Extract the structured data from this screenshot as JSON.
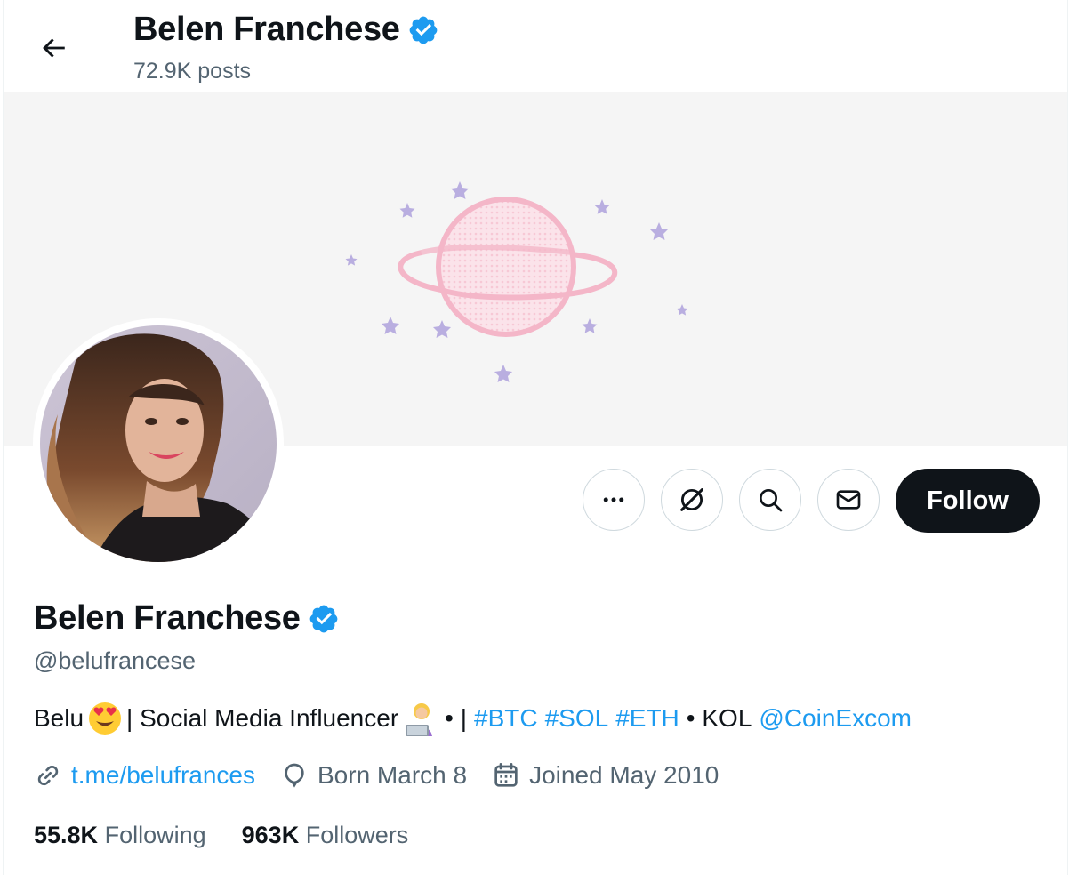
{
  "header": {
    "name": "Belen Franchese",
    "posts": "72.9K posts"
  },
  "profile": {
    "name": "Belen Franchese",
    "handle": "@belufrancese",
    "bio": {
      "part1": "Belu",
      "part2": "| Social Media Influencer",
      "part3": "• |",
      "tag_btc": "#BTC",
      "tag_sol": "#SOL",
      "tag_eth": "#ETH",
      "part4": "• KOL",
      "mention": "@CoinExcom"
    },
    "url": "t.me/belufrances",
    "birthday": "Born March 8",
    "joined": "Joined May 2010",
    "following_count": "55.8K",
    "following_label": "Following",
    "followers_count": "963K",
    "followers_label": "Followers"
  },
  "actions": {
    "follow_label": "Follow"
  },
  "icons": {
    "back": "arrow-left-icon",
    "verified": "verified-badge-icon",
    "more": "more-icon",
    "grok": "grok-icon",
    "search": "search-icon",
    "message": "envelope-icon",
    "link": "link-icon",
    "balloon": "balloon-icon",
    "calendar": "calendar-icon"
  },
  "colors": {
    "accent": "#1d9bf0",
    "text": "#0f1419",
    "secondary": "#536471",
    "follow_bg": "#0f1419",
    "banner_bg": "#f5f5f5",
    "planet": "#f4b6c8",
    "stars": "#b9aee0"
  }
}
